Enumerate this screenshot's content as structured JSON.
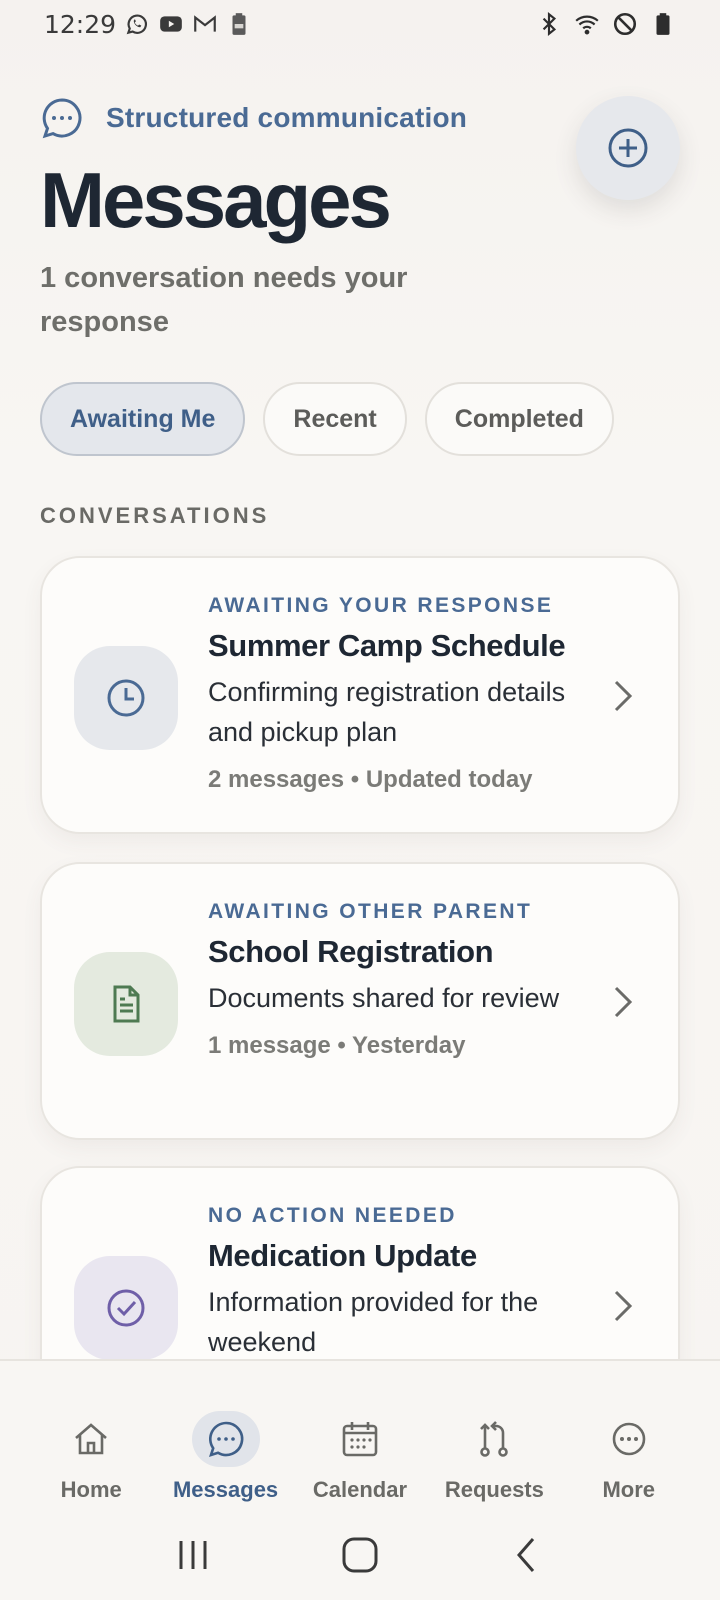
{
  "status_bar": {
    "time": "12:29",
    "left_icons": [
      "whatsapp-icon",
      "youtube-icon",
      "gmail-icon",
      "battery-saver-icon"
    ],
    "right_icons": [
      "bluetooth-icon",
      "wifi-icon",
      "do-not-disturb-icon",
      "battery-icon"
    ]
  },
  "header": {
    "eyebrow": "Structured communication",
    "title": "Messages",
    "subtitle": "1 conversation needs your response"
  },
  "tabs": [
    {
      "label": "Awaiting Me",
      "active": true
    },
    {
      "label": "Recent",
      "active": false
    },
    {
      "label": "Completed",
      "active": false
    }
  ],
  "section_label": "CONVERSATIONS",
  "conversations": [
    {
      "status": "AWAITING YOUR RESPONSE",
      "title": "Summer Camp Schedule",
      "description": "Confirming registration details and pickup plan",
      "meta": "2 messages • Updated today",
      "icon": "clock-icon"
    },
    {
      "status": "AWAITING OTHER PARENT",
      "title": "School Registration",
      "description": "Documents shared for review",
      "meta": "1 message • Yesterday",
      "icon": "document-icon"
    },
    {
      "status": "NO ACTION NEEDED",
      "title": "Medication Update",
      "description": "Information provided for the weekend",
      "meta": "",
      "icon": "check-circle-icon"
    }
  ],
  "bottom_nav": [
    {
      "label": "Home",
      "icon": "home-icon",
      "active": false
    },
    {
      "label": "Messages",
      "icon": "chat-icon",
      "active": true
    },
    {
      "label": "Calendar",
      "icon": "calendar-icon",
      "active": false
    },
    {
      "label": "Requests",
      "icon": "requests-icon",
      "active": false
    },
    {
      "label": "More",
      "icon": "more-icon",
      "active": false
    }
  ],
  "colors": {
    "accent": "#4a6a94",
    "title": "#1e2733",
    "clock_tile": "#e6e8ec",
    "document_tile": "#e4eadf",
    "check_tile": "#e9e6f0"
  }
}
